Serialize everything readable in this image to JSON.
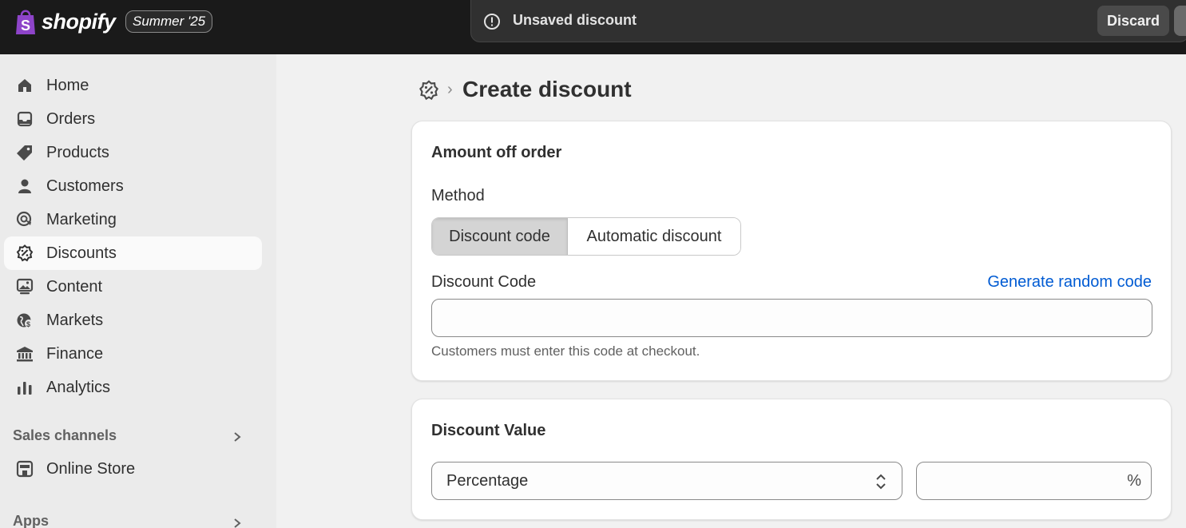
{
  "topbar": {
    "brand": "shopify",
    "season_badge": "Summer '25",
    "save_bar": {
      "message": "Unsaved discount",
      "discard_label": "Discard"
    }
  },
  "sidebar": {
    "items": [
      {
        "label": "Home",
        "icon": "home-icon",
        "active": false
      },
      {
        "label": "Orders",
        "icon": "inbox-icon",
        "active": false
      },
      {
        "label": "Products",
        "icon": "tag-icon",
        "active": false
      },
      {
        "label": "Customers",
        "icon": "person-icon",
        "active": false
      },
      {
        "label": "Marketing",
        "icon": "target-icon",
        "active": false
      },
      {
        "label": "Discounts",
        "icon": "discount-icon",
        "active": true
      },
      {
        "label": "Content",
        "icon": "image-icon",
        "active": false
      },
      {
        "label": "Markets",
        "icon": "globe-icon",
        "active": false
      },
      {
        "label": "Finance",
        "icon": "bank-icon",
        "active": false
      },
      {
        "label": "Analytics",
        "icon": "bar-chart-icon",
        "active": false
      }
    ],
    "sales_channels_title": "Sales channels",
    "online_store": "Online Store",
    "apps_title": "Apps"
  },
  "main": {
    "breadcrumb_icon": "discount-icon",
    "title": "Create discount",
    "card1": {
      "title": "Amount off order",
      "method_label": "Method",
      "method_options": [
        "Discount code",
        "Automatic discount"
      ],
      "method_selected": "Discount code",
      "code_label": "Discount Code",
      "generate_link": "Generate random code",
      "code_value": "",
      "help_text": "Customers must enter this code at checkout."
    },
    "card2": {
      "title": "Discount Value",
      "type_value": "Percentage",
      "amount_value": "",
      "amount_suffix": "%"
    }
  },
  "colors": {
    "topbar_bg": "#1a1a1a",
    "link": "#005bd3",
    "brand_bag": "#95bf47"
  }
}
